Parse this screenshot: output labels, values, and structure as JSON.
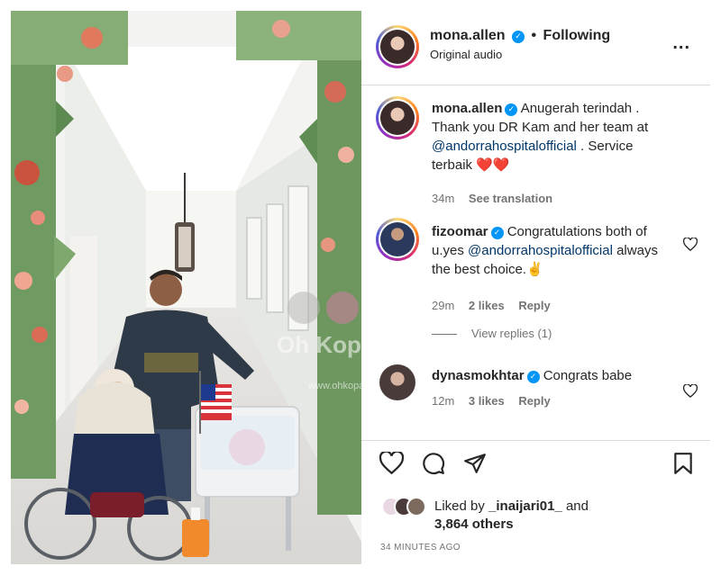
{
  "post": {
    "author": "mona.allen",
    "follow_sep": "•",
    "follow_label": "Following",
    "audio": "Original audio",
    "more": "..."
  },
  "caption": {
    "user": "mona.allen",
    "text_1": "Anugerah terindah . Thank you DR Kam and her team at ",
    "mention": "@andorrahospitalofficial",
    "text_2": " . Service terbaik ",
    "emoji": "❤️❤️",
    "time": "34m",
    "translate": "See translation"
  },
  "comments": [
    {
      "user": "fizoomar",
      "text_1": "Congratulations both of u.yes ",
      "mention": "@andorrahospitalofficial",
      "text_2": " always the best choice.",
      "emoji": "✌️",
      "time": "29m",
      "likes": "2 likes",
      "reply": "Reply"
    },
    {
      "user": "dynasmokhtar",
      "text_1": "Congrats babe",
      "time": "12m",
      "likes": "3 likes",
      "reply": "Reply"
    }
  ],
  "view_replies": "View replies (1)",
  "liked": {
    "prefix": "Liked by ",
    "user": "_inaijari01_",
    "and": " and",
    "others": "3,864 others"
  },
  "timestamp": "34 MINUTES AGO",
  "photo": {
    "watermark": "Oh Kopak",
    "watermark_small": "www.ohkopak.com"
  },
  "icons": {
    "more": "more-options-icon",
    "heart": "heart-icon",
    "comment": "comment-icon",
    "share": "share-icon",
    "save": "bookmark-icon"
  }
}
